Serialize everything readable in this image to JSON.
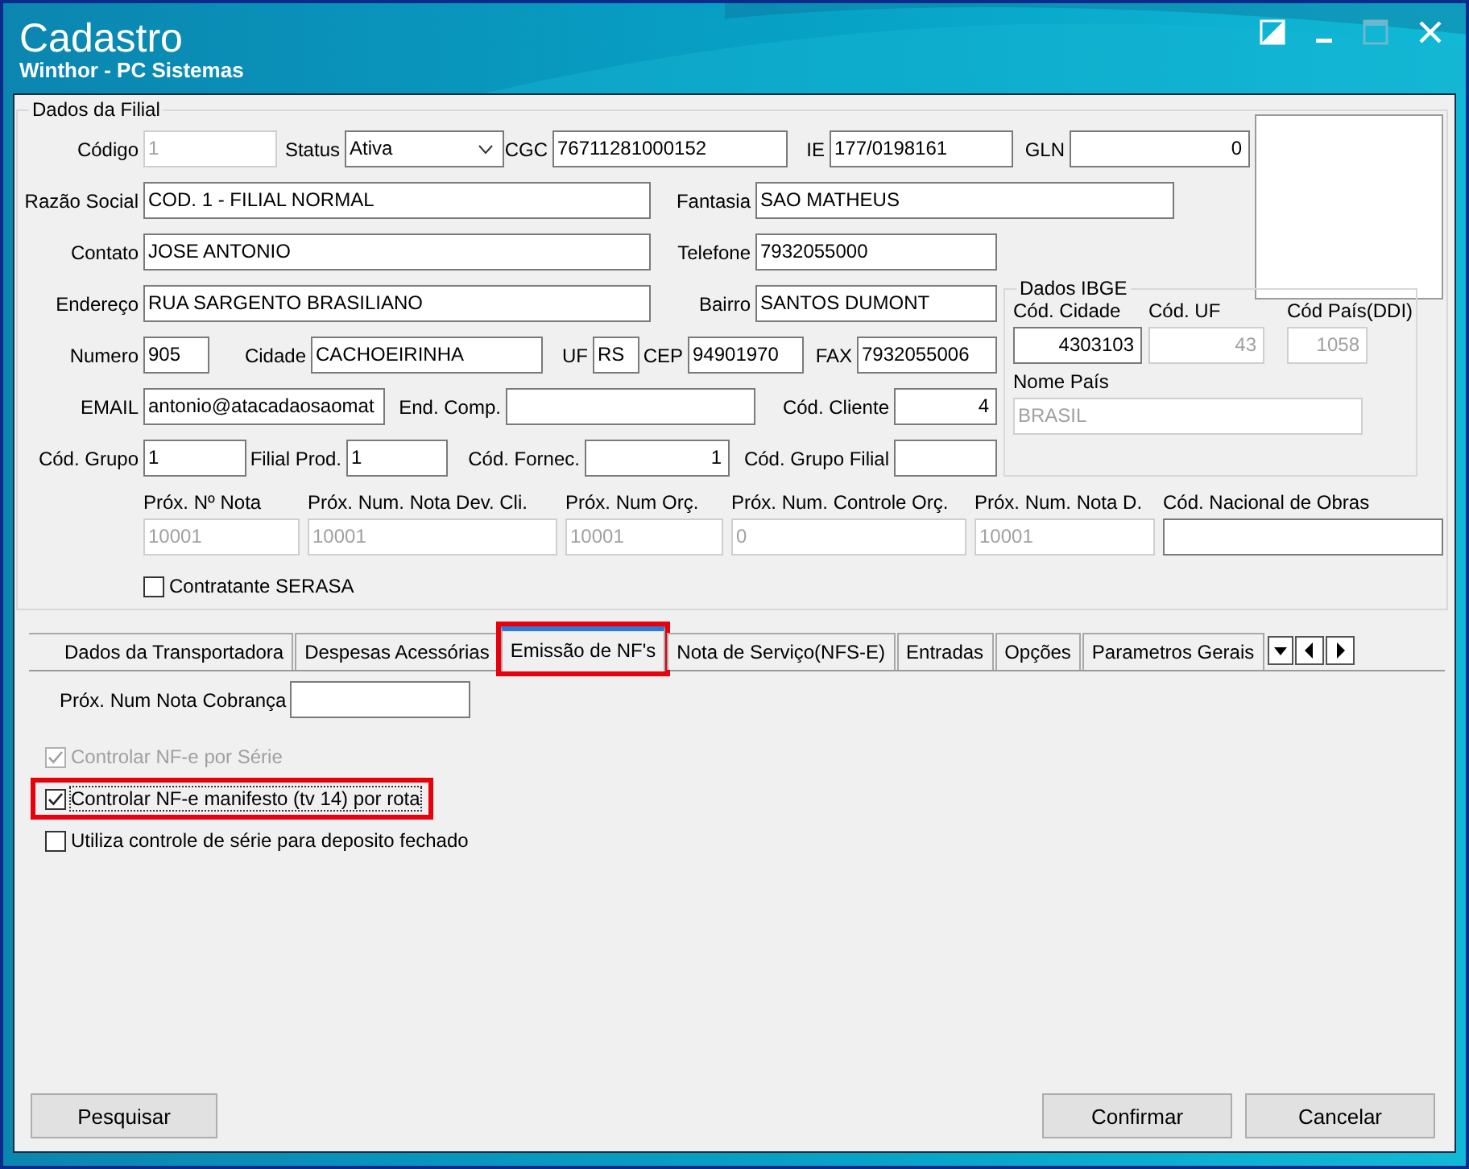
{
  "window": {
    "title": "Cadastro",
    "subtitle": "Winthor - PC Sistemas"
  },
  "dados_filial": {
    "title": "Dados da Filial",
    "fields": [
      {
        "label": "Código",
        "value": "1",
        "disabled": true,
        "kind": "text"
      },
      {
        "label": "Status",
        "value": "Ativa",
        "disabled": false,
        "kind": "select"
      },
      {
        "label": "CGC",
        "value": "76711281000152",
        "disabled": false,
        "kind": "text"
      },
      {
        "label": "IE",
        "value": "177/0198161",
        "disabled": false,
        "kind": "text"
      },
      {
        "label": "GLN",
        "value": "0",
        "disabled": false,
        "kind": "text"
      },
      {
        "label": "Razão Social",
        "value": "COD. 1 - FILIAL NORMAL",
        "disabled": false,
        "kind": "text"
      },
      {
        "label": "Fantasia",
        "value": "SAO MATHEUS",
        "disabled": false,
        "kind": "text"
      },
      {
        "label": "Contato",
        "value": "JOSE ANTONIO",
        "disabled": false,
        "kind": "text"
      },
      {
        "label": "Telefone",
        "value": "7932055000",
        "disabled": false,
        "kind": "text"
      },
      {
        "label": "Endereço",
        "value": "RUA SARGENTO BRASILIANO",
        "disabled": false,
        "kind": "text"
      },
      {
        "label": "Bairro",
        "value": "SANTOS DUMONT",
        "disabled": false,
        "kind": "text"
      },
      {
        "label": "Numero",
        "value": "905",
        "disabled": false,
        "kind": "text"
      },
      {
        "label": "Cidade",
        "value": "CACHOEIRINHA",
        "disabled": false,
        "kind": "text"
      },
      {
        "label": "UF",
        "value": "RS",
        "disabled": false,
        "kind": "text"
      },
      {
        "label": "CEP",
        "value": "94901970",
        "disabled": false,
        "kind": "text"
      },
      {
        "label": "FAX",
        "value": "7932055006",
        "disabled": false,
        "kind": "text"
      },
      {
        "label": "EMAIL",
        "value": "antonio@atacadaosaomat",
        "disabled": false,
        "kind": "text"
      },
      {
        "label": "End. Comp.",
        "disabled": false,
        "kind": "text"
      },
      {
        "label": "Cód. Cliente",
        "value": "4",
        "disabled": false,
        "kind": "text"
      },
      {
        "label": "Cód. Grupo",
        "value": "1",
        "disabled": false,
        "kind": "text"
      },
      {
        "label": "Filial Prod.",
        "value": "1",
        "disabled": false,
        "kind": "text"
      },
      {
        "label": "Cód. Fornec.",
        "value": "1",
        "disabled": false,
        "kind": "text"
      },
      {
        "label": "Cód. Grupo Filial",
        "disabled": false,
        "kind": "text"
      }
    ],
    "ibge": {
      "title": "Dados IBGE",
      "fields": [
        {
          "label": "Cód. Cidade",
          "value": "4303103",
          "disabled": false
        },
        {
          "label": "Cód. UF",
          "value": "43",
          "disabled": true
        },
        {
          "label": "Cód País(DDI)",
          "value": "1058",
          "disabled": true
        },
        {
          "label": "Nome País",
          "value": "BRASIL",
          "disabled": true
        }
      ]
    },
    "numeracao": [
      {
        "label": "Próx. Nº Nota",
        "value": "10001",
        "disabled": true
      },
      {
        "label": "Próx. Num. Nota Dev. Cli.",
        "value": "10001",
        "disabled": true
      },
      {
        "label": "Próx. Num Orç.",
        "value": "10001",
        "disabled": true
      },
      {
        "label": "Próx. Num. Controle Orç.",
        "value": "0",
        "disabled": true
      },
      {
        "label": "Próx. Num. Nota D.",
        "value": "10001",
        "disabled": true
      },
      {
        "label": "Cód. Nacional de Obras",
        "disabled": false
      }
    ],
    "contratante_serasa": {
      "label": "Contratante SERASA",
      "checked": false,
      "disabled": false
    }
  },
  "tabs": [
    {
      "label": "Dados da Transportadora",
      "selected": false,
      "highlighted": false
    },
    {
      "label": "Despesas Acessórias",
      "selected": false,
      "highlighted": false
    },
    {
      "label": "Emissão de NF's",
      "selected": true,
      "highlighted": true
    },
    {
      "label": "Nota de Serviço(NFS-E)",
      "selected": false,
      "highlighted": false
    },
    {
      "label": "Entradas",
      "selected": false,
      "highlighted": false
    },
    {
      "label": "Opções",
      "selected": false,
      "highlighted": false
    },
    {
      "label": "Parametros Gerais",
      "selected": false,
      "highlighted": false
    }
  ],
  "tab_panel": {
    "field": {
      "label": "Próx. Num Nota Cobrança",
      "disabled": false
    },
    "checkboxes": [
      {
        "label": "Controlar NF-e por Série",
        "checked": true,
        "disabled": true,
        "highlighted": false
      },
      {
        "label": "Controlar NF-e manifesto (tv 14) por rota",
        "checked": true,
        "disabled": false,
        "highlighted": true
      },
      {
        "label": "Utiliza controle de série para deposito fechado",
        "checked": false,
        "disabled": false,
        "highlighted": false
      }
    ]
  },
  "buttons": [
    {
      "label": "Pesquisar",
      "kind": "left"
    },
    {
      "label": "Confirmar",
      "kind": "right"
    },
    {
      "label": "Cancelar",
      "kind": "right"
    }
  ]
}
